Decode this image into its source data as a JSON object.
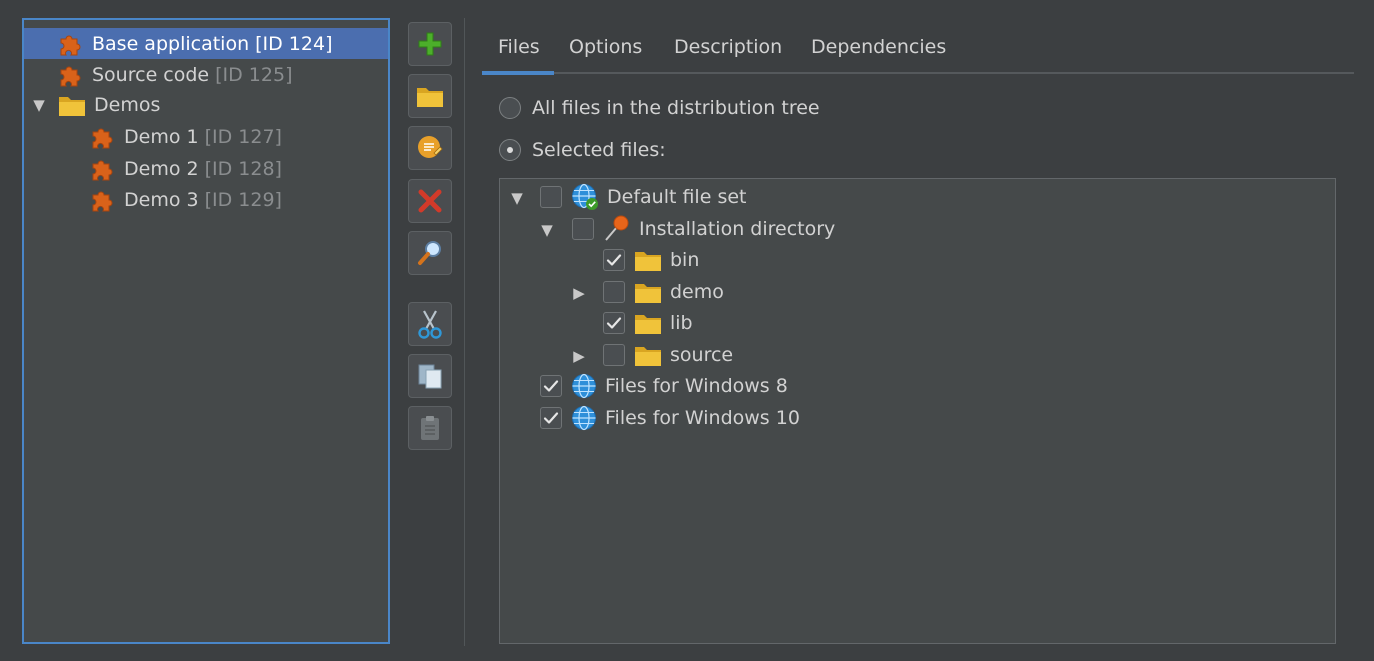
{
  "left_tree": [
    {
      "label": "Base application",
      "id": "[ID 124]",
      "icon": "puzzle-icon",
      "selected": true
    },
    {
      "label": "Source code",
      "id": "[ID 125]",
      "icon": "puzzle-icon"
    },
    {
      "label": "Demos",
      "id": "",
      "icon": "folder-icon",
      "expanded": true
    },
    {
      "label": "Demo 1",
      "id": "[ID 127]",
      "icon": "puzzle-icon"
    },
    {
      "label": "Demo 2",
      "id": "[ID 128]",
      "icon": "puzzle-icon"
    },
    {
      "label": "Demo 3",
      "id": "[ID 129]",
      "icon": "puzzle-icon"
    }
  ],
  "toolbar": {
    "buttons": [
      "add-icon",
      "folder-icon",
      "rename-icon",
      "delete-icon",
      "search-icon",
      "cut-icon",
      "copy-icon",
      "paste-icon"
    ]
  },
  "tabs": [
    "Files",
    "Options",
    "Description",
    "Dependencies"
  ],
  "active_tab": "Files",
  "radios": {
    "all_files": "All files in the distribution tree",
    "selected_files": "Selected files:",
    "selected": "selected_files"
  },
  "file_tree": [
    {
      "label": "Default file set",
      "checked": false,
      "icon": "globe-check-icon",
      "expanded": true
    },
    {
      "label": "Installation directory",
      "checked": false,
      "icon": "pin-icon",
      "expanded": true
    },
    {
      "label": "bin",
      "checked": true,
      "icon": "folder-icon"
    },
    {
      "label": "demo",
      "checked": false,
      "icon": "folder-icon",
      "expanded": false
    },
    {
      "label": "lib",
      "checked": true,
      "icon": "folder-icon"
    },
    {
      "label": "source",
      "checked": false,
      "icon": "folder-icon",
      "expanded": false
    },
    {
      "label": "Files for Windows 8",
      "checked": true,
      "icon": "globe-icon"
    },
    {
      "label": "Files for Windows 10",
      "checked": true,
      "icon": "globe-icon"
    }
  ],
  "colors": {
    "accent": "#4a86c8",
    "selection": "#4b6eaf",
    "puzzle": "#d9621a",
    "folder": "#e8b92d"
  }
}
